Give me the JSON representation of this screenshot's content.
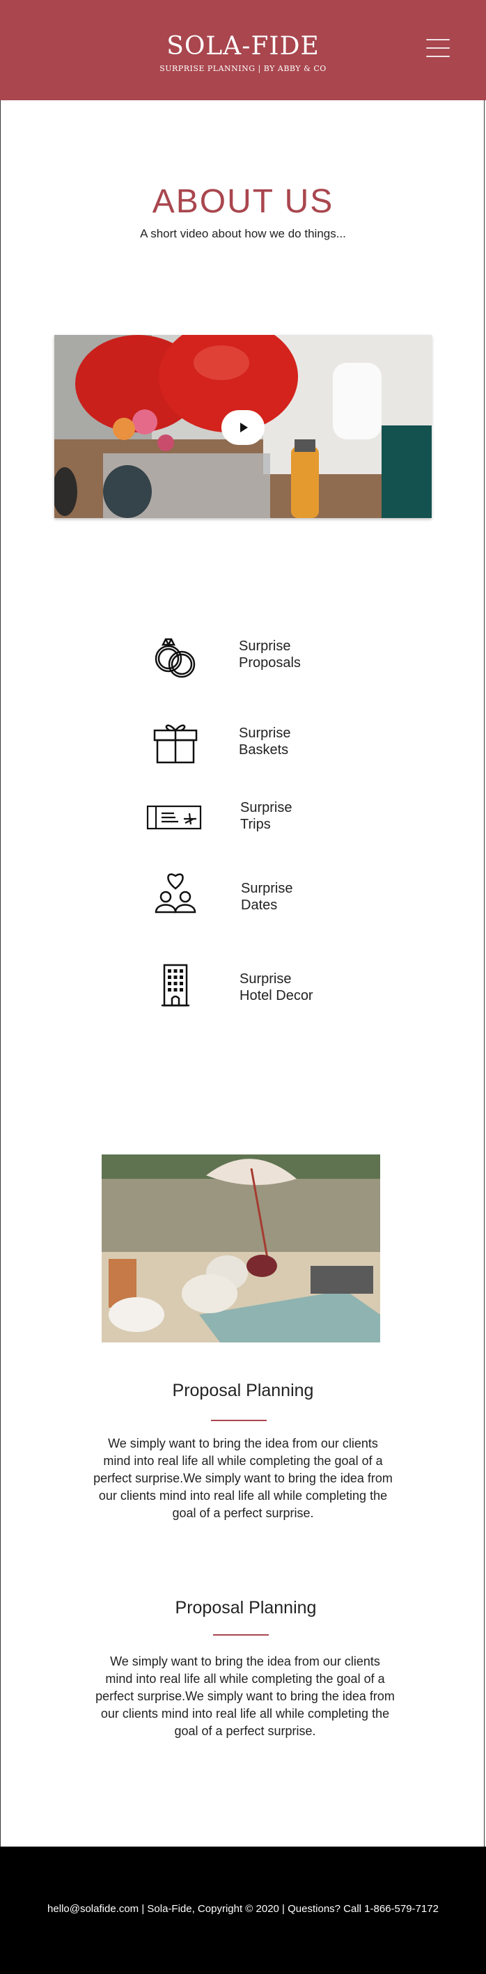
{
  "header": {
    "brand": "SOLA-FIDE",
    "tagline": "SURPRISE PLANNING | BY ABBY & CO",
    "menu_icon": "hamburger-menu-icon",
    "color": "#a9464e"
  },
  "about": {
    "title": "ABOUT US",
    "subtitle": "A short video about how we do things..."
  },
  "video": {
    "play_icon": "play-icon"
  },
  "services": [
    {
      "icon": "rings-icon",
      "line1": "Surprise",
      "line2": "Proposals"
    },
    {
      "icon": "gift-box-icon",
      "line1": "Surprise",
      "line2": "Baskets"
    },
    {
      "icon": "plane-ticket-icon",
      "line1": "Surprise",
      "line2": "Trips"
    },
    {
      "icon": "couple-heart-icon",
      "line1": "Surprise",
      "line2": "Dates"
    },
    {
      "icon": "hotel-building-icon",
      "line1": "Surprise",
      "line2": "Hotel Decor"
    }
  ],
  "sections": [
    {
      "title": "Proposal Planning",
      "body_lines": [
        "We simply want to bring the idea from our clients",
        "mind into real life all while completing the goal of a",
        "perfect surprise.We simply want to bring the idea from",
        "our clients mind into real life all while completing the",
        "goal of a perfect surprise."
      ]
    },
    {
      "title": "Proposal Planning",
      "body_lines": [
        "We simply want to bring the idea from our clients",
        "mind into real life all while completing the goal of a",
        "perfect surprise.We simply want to bring the idea from",
        "our clients mind into real life all while completing the",
        "goal of a perfect surprise."
      ]
    }
  ],
  "footer": {
    "text": "hello@solafide.com | Sola-Fide, Copyright © 2020 | Questions? Call 1-866-579-7172"
  },
  "colors": {
    "accent": "#a9464e",
    "footer_bg": "#000000"
  }
}
